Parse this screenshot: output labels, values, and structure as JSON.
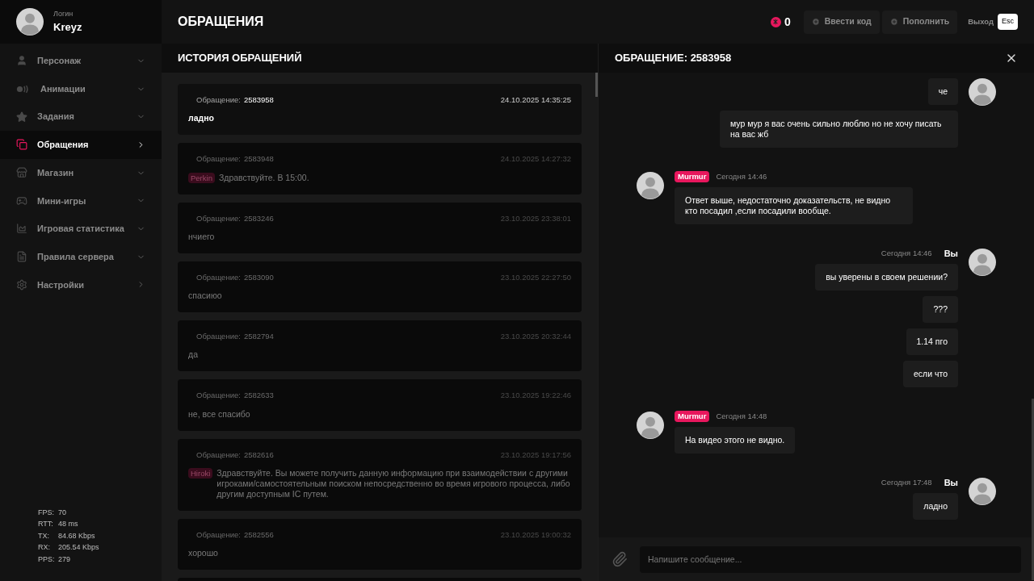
{
  "profile": {
    "caption": "Логин",
    "login": "Kreyz"
  },
  "menu": [
    {
      "label": "Персонаж",
      "selected": false,
      "kind": "dropdown"
    },
    {
      "label": "Анимации",
      "selected": false,
      "kind": "dropdown"
    },
    {
      "label": "Задания",
      "selected": false,
      "kind": "dropdown"
    },
    {
      "label": "Обращения",
      "selected": true,
      "kind": "link"
    },
    {
      "label": "Магазин",
      "selected": false,
      "kind": "dropdown"
    },
    {
      "label": "Мини-игры",
      "selected": false,
      "kind": "dropdown"
    },
    {
      "label": "Игровая статистика",
      "selected": false,
      "kind": "dropdown"
    },
    {
      "label": "Правила сервера",
      "selected": false,
      "kind": "dropdown"
    },
    {
      "label": "Настройки",
      "selected": false,
      "kind": "link"
    }
  ],
  "stats": [
    {
      "label": "FPS:",
      "value": "70"
    },
    {
      "label": "RTT:",
      "value": "48 ms"
    },
    {
      "label": "TX:",
      "value": "84.68 Kbps"
    },
    {
      "label": "RX:",
      "value": "205.54 Kbps"
    },
    {
      "label": "PPS:",
      "value": "279"
    }
  ],
  "header": {
    "title": "ОБРАЩЕНИЯ",
    "balance": "0",
    "buttons": [
      "Ввести код",
      "Пополнить"
    ],
    "exit_label": "Выход",
    "exit_key": "Esc"
  },
  "history": {
    "title": "ИСТОРИЯ ОБРАЩЕНИЙ",
    "tickets": [
      {
        "label": "Обращение:",
        "number": "2583958",
        "date": "24.10.2025 14:35:25",
        "text": "ладно",
        "selected": true
      },
      {
        "label": "Обращение:",
        "number": "2583948",
        "date": "24.10.2025 14:27:32",
        "author": "Perkin",
        "text": "Здравствуйте. В 15:00.",
        "selected": false
      },
      {
        "label": "Обращение:",
        "number": "2583246",
        "date": "23.10.2025 23:38:01",
        "text": "нчиего",
        "selected": false
      },
      {
        "label": "Обращение:",
        "number": "2583090",
        "date": "23.10.2025 22:27:50",
        "text": "спасиюо",
        "selected": false
      },
      {
        "label": "Обращение:",
        "number": "2582794",
        "date": "23.10.2025 20:32:44",
        "text": "да",
        "selected": false
      },
      {
        "label": "Обращение:",
        "number": "2582633",
        "date": "23.10.2025 19:22:46",
        "text": "не, все спасибо",
        "selected": false
      },
      {
        "label": "Обращение:",
        "number": "2582616",
        "date": "23.10.2025 19:17:56",
        "author": "Hiroki",
        "text": "Здравствуйте. Вы можете получить данную информацию при взаимодействии с другими игроками/самостоятельным поиском непосредственно во время игрового процесса, либо другим доступным IC путем.",
        "selected": false
      },
      {
        "label": "Обращение:",
        "number": "2582556",
        "date": "23.10.2025 19:00:32",
        "text": "хорошо",
        "selected": false
      }
    ]
  },
  "chat": {
    "title": "ОБРАЩЕНИЕ: 2583958",
    "input_placeholder": "Напишите сообщение...",
    "groups": [
      {
        "kind": "own",
        "messages": [
          "че",
          "мур мур я вас очень сильно люблю но не хочу писать на вас жб"
        ]
      },
      {
        "kind": "staff",
        "author": "Murmur",
        "time": "Сегодня 14:46",
        "messages": [
          "Ответ выше, недостаточно доказательств, не видно кто посадил ,если посадили вообще."
        ]
      },
      {
        "kind": "own",
        "author": "Вы",
        "time": "Сегодня 14:46",
        "messages": [
          "вы уверены в своем решении?",
          "???",
          "1.14 пго",
          "если что"
        ]
      },
      {
        "kind": "staff",
        "author": "Murmur",
        "time": "Сегодня 14:48",
        "messages": [
          "На видео этого не видно."
        ]
      },
      {
        "kind": "own",
        "author": "Вы",
        "time": "Сегодня 17:48",
        "messages": [
          "ладно"
        ]
      }
    ]
  }
}
